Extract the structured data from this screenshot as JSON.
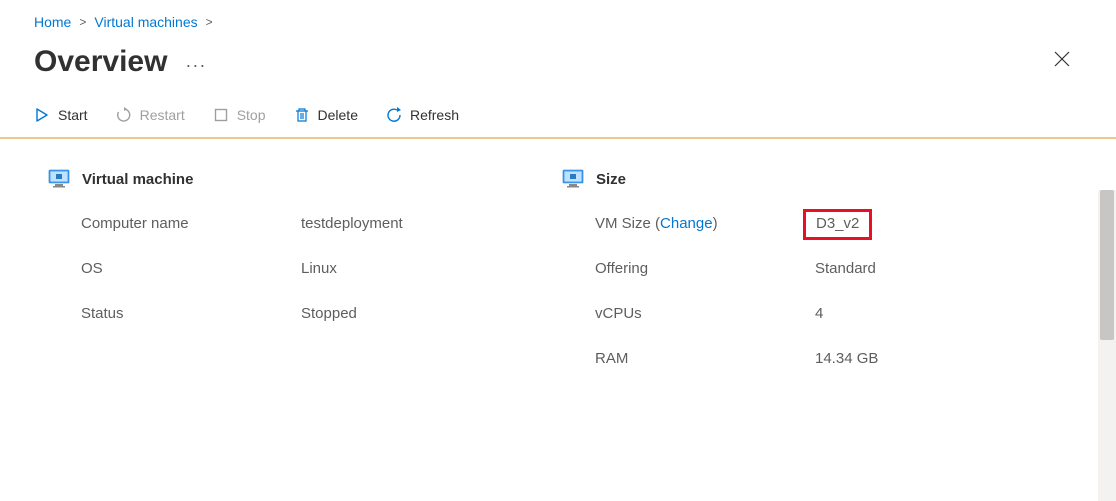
{
  "breadcrumb": {
    "home": "Home",
    "vms": "Virtual machines"
  },
  "page": {
    "title": "Overview",
    "ellipsis": "···"
  },
  "toolbar": {
    "start": "Start",
    "restart": "Restart",
    "stop": "Stop",
    "delete": "Delete",
    "refresh": "Refresh"
  },
  "sections": {
    "vm": {
      "title": "Virtual machine",
      "computer_name_label": "Computer name",
      "computer_name_value": "testdeployment",
      "os_label": "OS",
      "os_value": "Linux",
      "status_label": "Status",
      "status_value": "Stopped"
    },
    "size": {
      "title": "Size",
      "vmsize_label_prefix": "VM Size (",
      "vmsize_change": "Change",
      "vmsize_label_suffix": ")",
      "vmsize_value": "D3_v2",
      "offering_label": "Offering",
      "offering_value": "Standard",
      "vcpus_label": "vCPUs",
      "vcpus_value": "4",
      "ram_label": "RAM",
      "ram_value": "14.34 GB"
    }
  },
  "colors": {
    "link": "#0078d4",
    "highlight": "#e81123",
    "toolbar_border": "#f0c78a"
  }
}
